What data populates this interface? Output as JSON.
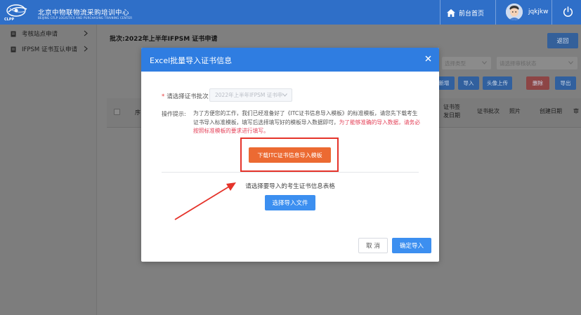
{
  "header": {
    "logo_cn": "北京中物联物流采购培训中心",
    "logo_en": "BEIJING CFLP LOGISTICS AND PURCHASING TRAINING CENTER",
    "logo_abbr": "CLPP",
    "home_label": "前台首页",
    "username": "jqkjkw"
  },
  "sidebar": {
    "items": [
      {
        "label": "考核站点申请"
      },
      {
        "label": "IFPSM 证书互认申请"
      }
    ]
  },
  "main": {
    "batch_title": "批次:2022年上半年IFPSM 证书申请",
    "back_label": "返回",
    "filter_type_placeholder": "选择类型",
    "filter_status_placeholder": "请选择审核状态",
    "toolbar": {
      "add": "新增",
      "import": "导入",
      "avatar_upload": "头像上传",
      "delete": "删除",
      "export": "导出"
    },
    "columns": {
      "seq": "序",
      "cert_issue_date": "证书签发日期",
      "cert_batch": "证书批次",
      "photo": "照片",
      "create_date": "创建日期",
      "review": "审"
    }
  },
  "modal": {
    "title": "Excel批量导入证书信息",
    "batch_label": "请选择证书批次",
    "batch_value": "2022年上半年IFPSM 证书申",
    "hint_label": "操作提示:",
    "hint_text": "为了方便您的工作，我们已经准备好了《ITC证书信息导入模板》的标准模板，请您先下载考生证书导入标准模板，填写后选择填写好的模板导入数据即可，",
    "hint_warning": "为了能够准确的导入数据，请务必按照标准模板的要求进行填写。",
    "download_label": "下载ITC证书信息导入模板",
    "upload_prompt": "请选择要导入的考生证书信息表格",
    "upload_label": "选择导入文件",
    "cancel_label": "取 消",
    "confirm_label": "确定导入"
  },
  "icons": {
    "home": "home-icon",
    "power": "power-icon",
    "close": "close-icon",
    "document": "document-icon",
    "chevron": "chevron-right-icon"
  },
  "colors": {
    "primary": "#2f7de1",
    "header_blue": "#2f6fc8",
    "download_orange": "#ec6a32",
    "highlight_red": "#e5332a",
    "warning_text": "#e4435a"
  }
}
